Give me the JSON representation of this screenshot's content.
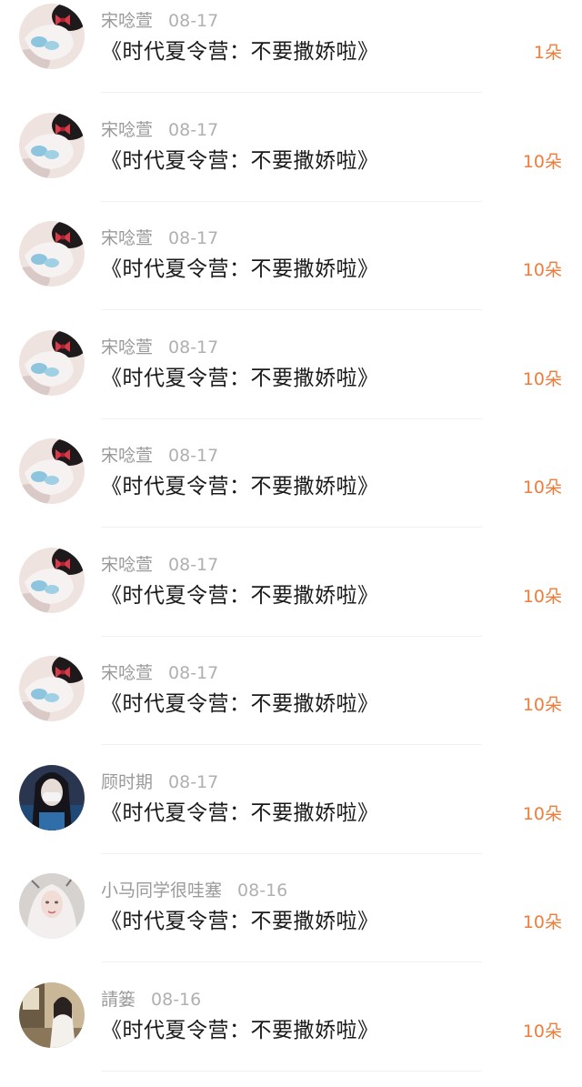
{
  "gift_list": {
    "items": [
      {
        "name": "宋唸萱",
        "date": "08-17",
        "title": "《时代夏令营：不要撒娇啦》",
        "amount": "1朵",
        "avatar": "avatar-bow"
      },
      {
        "name": "宋唸萱",
        "date": "08-17",
        "title": "《时代夏令营：不要撒娇啦》",
        "amount": "10朵",
        "avatar": "avatar-bow"
      },
      {
        "name": "宋唸萱",
        "date": "08-17",
        "title": "《时代夏令营：不要撒娇啦》",
        "amount": "10朵",
        "avatar": "avatar-bow"
      },
      {
        "name": "宋唸萱",
        "date": "08-17",
        "title": "《时代夏令营：不要撒娇啦》",
        "amount": "10朵",
        "avatar": "avatar-bow"
      },
      {
        "name": "宋唸萱",
        "date": "08-17",
        "title": "《时代夏令营：不要撒娇啦》",
        "amount": "10朵",
        "avatar": "avatar-bow"
      },
      {
        "name": "宋唸萱",
        "date": "08-17",
        "title": "《时代夏令营：不要撒娇啦》",
        "amount": "10朵",
        "avatar": "avatar-bow"
      },
      {
        "name": "宋唸萱",
        "date": "08-17",
        "title": "《时代夏令营：不要撒娇啦》",
        "amount": "10朵",
        "avatar": "avatar-bow"
      },
      {
        "name": "顾时期",
        "date": "08-17",
        "title": "《时代夏令营：不要撒娇啦》",
        "amount": "10朵",
        "avatar": "avatar-dark-hair"
      },
      {
        "name": "小马同学很哇塞",
        "date": "08-16",
        "title": "《时代夏令营：不要撒娇啦》",
        "amount": "10朵",
        "avatar": "avatar-white-hair"
      },
      {
        "name": "請篓",
        "date": "08-16",
        "title": "《时代夏令营：不要撒娇啦》",
        "amount": "10朵",
        "avatar": "avatar-room"
      }
    ]
  },
  "colors": {
    "amount": "#ee7d3b",
    "meta": "#a0a0a0",
    "title": "#1a1a1a",
    "divider": "#f1f1f1"
  }
}
